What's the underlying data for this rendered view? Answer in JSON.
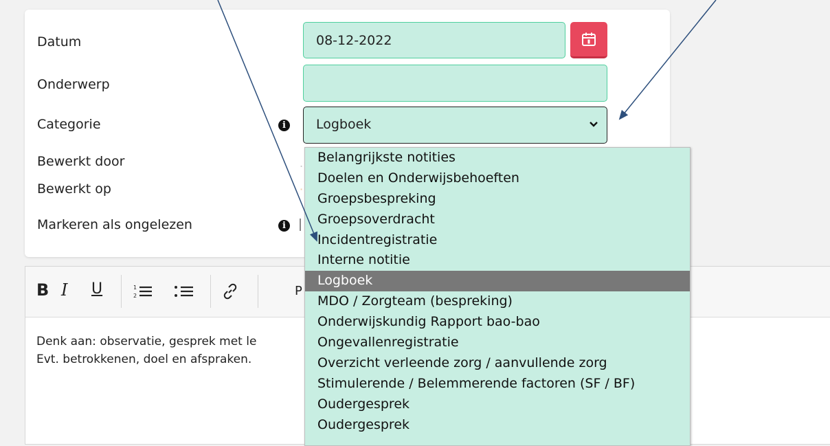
{
  "form": {
    "datum_label": "Datum",
    "datum_value": "08-12-2022",
    "onderwerp_label": "Onderwerp",
    "onderwerp_value": "",
    "categorie_label": "Categorie",
    "categorie_value": "Logboek",
    "bewerkt_door_label": "Bewerkt door",
    "bewerkt_op_label": "Bewerkt op",
    "markeren_label": "Markeren als ongelezen"
  },
  "dropdown": {
    "options": [
      "Belangrijkste notities",
      "Doelen en Onderwijsbehoeften",
      "Groepsbespreking",
      "Groepsoverdracht",
      "Incidentregistratie",
      "Interne notitie",
      "Logboek",
      "MDO / Zorgteam (bespreking)",
      "Onderwijskundig Rapport bao-bao",
      "Ongevallenregistratie",
      "Overzicht verleende zorg / aanvullende zorg",
      "Stimulerende / Belemmerende factoren (SF / BF)",
      "Oudergesprek",
      "Oudergesprek"
    ],
    "selected_index": 6
  },
  "editor": {
    "toolbar": {
      "bold": "B",
      "italic": "I",
      "underline": "U",
      "paragraph_partial": "P"
    },
    "line1": "Denk aan: observatie, gesprek met le",
    "line2": "Evt. betrokkenen, doel en afspraken."
  },
  "colors": {
    "field_bg": "#c8eee2",
    "field_border": "#4fcf9d",
    "calendar_button": "#e8475d",
    "selected_option_bg": "#787878"
  },
  "icons": [
    "calendar-icon",
    "info-icon",
    "chevron-down-icon",
    "ordered-list-icon",
    "unordered-list-icon",
    "link-icon"
  ]
}
